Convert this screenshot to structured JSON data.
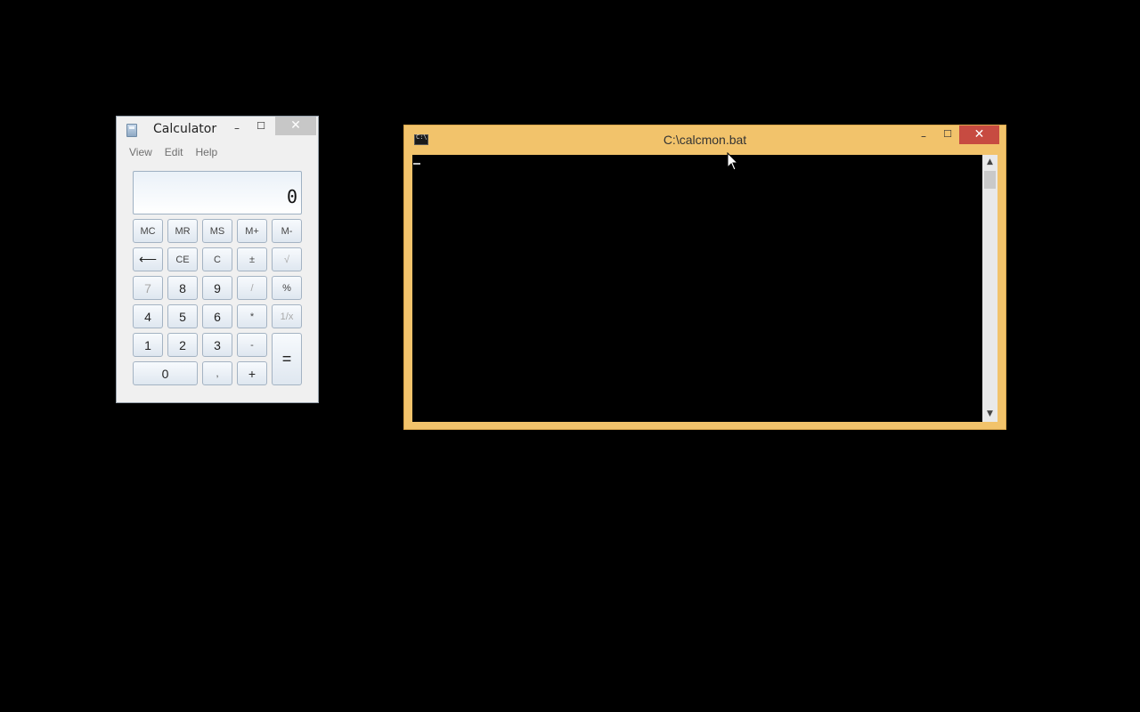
{
  "calculator": {
    "title": "Calculator",
    "window_controls": {
      "minimize": "–",
      "maximize": "☐",
      "close": "✕"
    },
    "menu": [
      "View",
      "Edit",
      "Help"
    ],
    "display": "0",
    "keys": {
      "mc": "MC",
      "mr": "MR",
      "ms": "MS",
      "mplus": "M+",
      "mminus": "M-",
      "backspace": "⟵",
      "ce": "CE",
      "c": "C",
      "plusminus": "±",
      "sqrt": "√",
      "k7": "7",
      "k8": "8",
      "k9": "9",
      "divide": "/",
      "percent": "%",
      "k4": "4",
      "k5": "5",
      "k6": "6",
      "multiply": "*",
      "reciprocal": "1/x",
      "k1": "1",
      "k2": "2",
      "k3": "3",
      "minus": "-",
      "equals": "=",
      "k0": "0",
      "decimal": ",",
      "plus": "+"
    }
  },
  "console": {
    "title": "C:\\calcmon.bat",
    "window_controls": {
      "minimize": "–",
      "maximize": "☐",
      "close": "✕"
    },
    "scrollbar": {
      "up_arrow": "▲",
      "down_arrow": "▼"
    }
  }
}
